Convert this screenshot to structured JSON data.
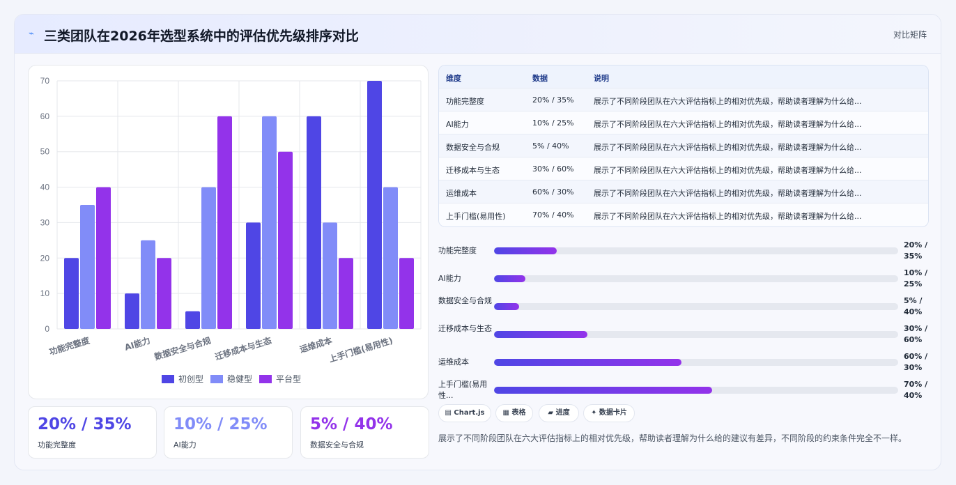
{
  "header": {
    "icon": "chart-line-icon",
    "title": "三类团队在2026年选型系统中的评估优先级排序对比",
    "link": "对比矩阵"
  },
  "colors": {
    "startup": "#4f46e5",
    "steady": "#818cf8",
    "platform": "#9333ea"
  },
  "chart_data": {
    "type": "bar",
    "categories": [
      "功能完整度",
      "AI能力",
      "数据安全与合规",
      "迁移成本与生态",
      "运维成本",
      "上手门槛(易用性)"
    ],
    "series": [
      {
        "name": "初创型",
        "values": [
          20,
          10,
          5,
          30,
          60,
          70
        ]
      },
      {
        "name": "稳健型",
        "values": [
          35,
          25,
          40,
          60,
          30,
          40
        ]
      },
      {
        "name": "平台型",
        "values": [
          40,
          20,
          60,
          50,
          20,
          20
        ]
      }
    ],
    "ylim": [
      0,
      70
    ],
    "yticks": [
      0,
      10,
      20,
      30,
      40,
      50,
      60,
      70
    ],
    "grid": true,
    "legend": "bottom"
  },
  "stats": [
    {
      "value": "20% / 35%",
      "label": "功能完整度"
    },
    {
      "value": "10% / 25%",
      "label": "AI能力"
    },
    {
      "value": "5% / 40%",
      "label": "数据安全与合规"
    }
  ],
  "table": {
    "headers": [
      "维度",
      "数据",
      "说明"
    ],
    "rows": [
      {
        "dim": "功能完整度",
        "data": "20% / 35%",
        "note": "展示了不同阶段团队在六大评估指标上的相对优先级，帮助读者理解为什么给..."
      },
      {
        "dim": "AI能力",
        "data": "10% / 25%",
        "note": "展示了不同阶段团队在六大评估指标上的相对优先级，帮助读者理解为什么给..."
      },
      {
        "dim": "数据安全与合规",
        "data": "5% / 40%",
        "note": "展示了不同阶段团队在六大评估指标上的相对优先级，帮助读者理解为什么给..."
      },
      {
        "dim": "迁移成本与生态",
        "data": "30% / 60%",
        "note": "展示了不同阶段团队在六大评估指标上的相对优先级，帮助读者理解为什么给..."
      },
      {
        "dim": "运维成本",
        "data": "60% / 30%",
        "note": "展示了不同阶段团队在六大评估指标上的相对优先级，帮助读者理解为什么给..."
      },
      {
        "dim": "上手门槛(易用性)",
        "data": "70% / 40%",
        "note": "展示了不同阶段团队在六大评估指标上的相对优先级，帮助读者理解为什么给..."
      }
    ]
  },
  "progress": [
    {
      "label": "功能完整度",
      "value": "20% / 35%",
      "fill": 0.155
    },
    {
      "label": "AI能力",
      "value": "10% / 25%",
      "fill": 0.078
    },
    {
      "label": "数据安全与合规",
      "value": "5% / 40%",
      "fill": 0.062
    },
    {
      "label": "迁移成本与生态",
      "value": "30% / 60%",
      "fill": 0.231
    },
    {
      "label": "运维成本",
      "value": "60% / 30%",
      "fill": 0.463
    },
    {
      "label": "上手门槛(易用性...",
      "value": "70% / 40%",
      "fill": 0.54
    }
  ],
  "tags": [
    {
      "label": "▤ Chart.js",
      "icon": "chart-icon"
    },
    {
      "label": "▦ 表格",
      "icon": "table-icon"
    },
    {
      "label": "▰ 进度",
      "icon": "progress-icon"
    },
    {
      "label": "✦ 数据卡片",
      "icon": "sparkle-icon"
    }
  ],
  "description": "展示了不同阶段团队在六大评估指标上的相对优先级，帮助读者理解为什么给的建议有差异，不同阶段的约束条件完全不一样。"
}
